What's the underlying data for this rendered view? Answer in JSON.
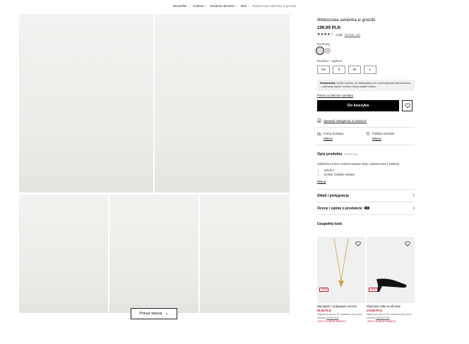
{
  "breadcrumb": {
    "items": [
      "Bestseller",
      "Kobieta",
      "Sukienki damskie",
      "Midi",
      "Wiskozowa sukienka w groszki"
    ]
  },
  "gallery": {
    "show_more_label": "Pokaż więcej"
  },
  "product": {
    "title": "Wiskozowa sukienka w groszki",
    "price": "199,99 PLN",
    "rating_stars": "★★★★☆",
    "rating_value": "4,3/5",
    "rating_count": "(Ocena: 18)",
    "color_label": "Kremowy",
    "colors": [
      "#ece3d7",
      "#e7c9cc"
    ],
    "size_label": "Rozmiar – wybierz",
    "sizes": [
      "XS",
      "S",
      "M",
      "L"
    ],
    "notice_bold": "Wskazówka:",
    "notice_text": "Krótki rozmiar, ze wskazówką, że numeracja jest standardowa – zalecamy wybór numeru, który zwykle nosisz.",
    "size_guide_link": "Pomoc w doborze rozmiaru",
    "add_to_cart_label": "Do koszyka",
    "store_link": "Sprawdź dostępność w salonach",
    "delivery": {
      "shipping_title": "Formy dostawy",
      "shipping_link": "Więcej",
      "returns_title": "Polityka zwrotów",
      "returns_link": "Więcej"
    },
    "description_heading": "Opis produktu",
    "description_code": "6183Q-00X",
    "description_text": "Sukienka o luźno rozkloszowanym kroju, wykończona z wiskozy.",
    "bullets": [
      "dekolt V",
      "krótkie, bufiaste rękawy"
    ],
    "more_link": "Więcej",
    "accordions": [
      {
        "label": "Skład i pielęgnacja",
        "badge": ""
      },
      {
        "label": "Oceny i opinie o produkcie",
        "badge": "18"
      }
    ],
    "look_heading": "Uzupełnij look"
  },
  "looks": [
    {
      "discount": "-25%",
      "name": "Naszyjnik z mołgowym sercem",
      "price": "29,99 PLN",
      "old_price_text": "Najniższa cena z 30 ostatnich dni przed obniżką",
      "old_price": "39,99 PLN",
      "promo": "-25% Z KODEM RABATU"
    },
    {
      "discount": "-25%",
      "name": "Skórzane muły na obcasie",
      "price": "179,99 PLN",
      "old_price_text": "Najniższa cena z 30 ostatnich dni przed obniżką",
      "old_price": "239,99 PLN",
      "promo": "-25% Z KODEM RABATU"
    }
  ],
  "colors": {
    "accent_sale": "#c8102e",
    "button": "#000000",
    "dress": "#f4ede2",
    "dots": "#111111"
  }
}
